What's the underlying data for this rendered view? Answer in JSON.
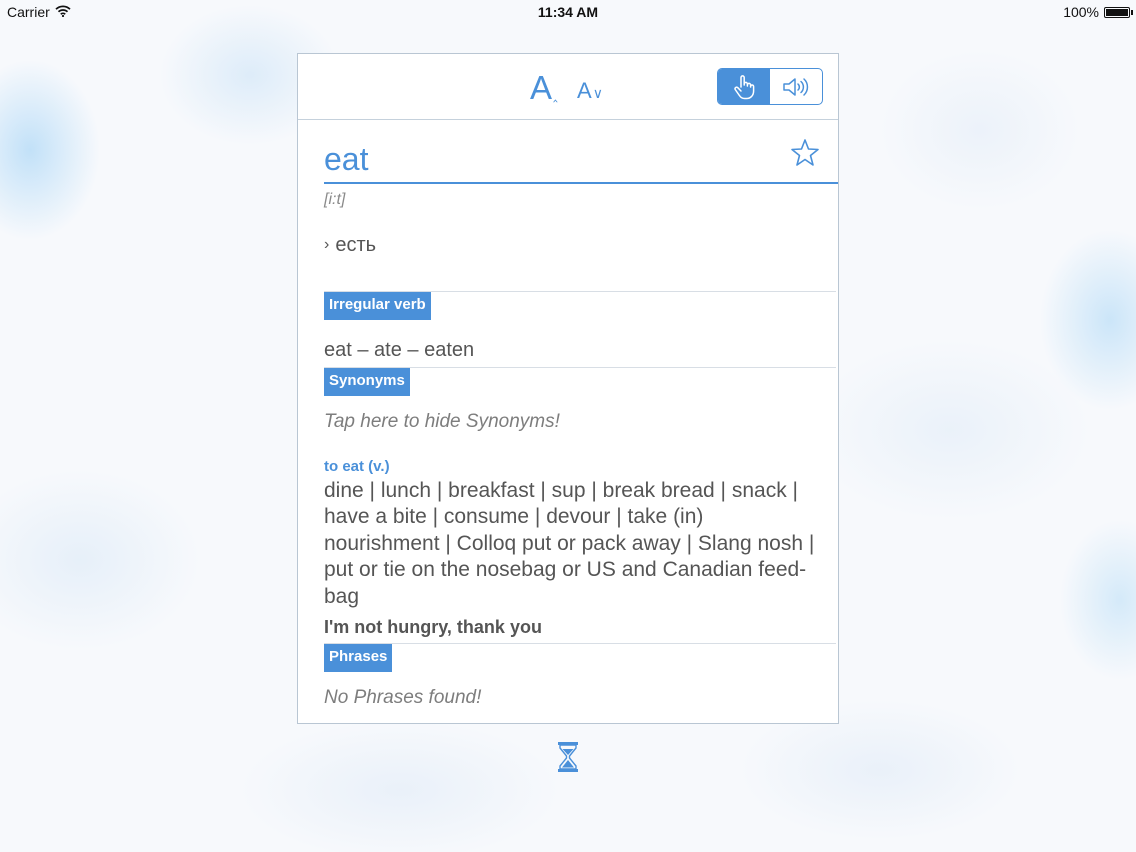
{
  "status_bar": {
    "carrier": "Carrier",
    "time": "11:34 AM",
    "battery": "100%"
  },
  "toolbar": {
    "font_increase_label": "A",
    "font_decrease_label": "A",
    "accent_color": "#4a90d9"
  },
  "entry": {
    "word": "eat",
    "transcription": "[i:t]",
    "translation": "есть"
  },
  "sections": {
    "irregular_verb": {
      "title": "Irregular verb",
      "forms": "eat – ate – eaten"
    },
    "synonyms": {
      "title": "Synonyms",
      "hint": "Tap here to hide Synonyms!",
      "part_of_speech": "to eat (v.)",
      "list": "dine | lunch | breakfast | sup | break bread | snack | have a bite | consume | devour | take (in) nourishment | Colloq put or pack away | Slang nosh | put or tie on the nosebag or US and Canadian feed-bag",
      "example": "I'm not hungry, thank you"
    },
    "phrases": {
      "title": "Phrases",
      "empty": "No Phrases found!"
    }
  },
  "icons": [
    "wifi-icon",
    "battery-icon",
    "hand-tap-icon",
    "speaker-icon",
    "star-icon",
    "hourglass-icon"
  ]
}
